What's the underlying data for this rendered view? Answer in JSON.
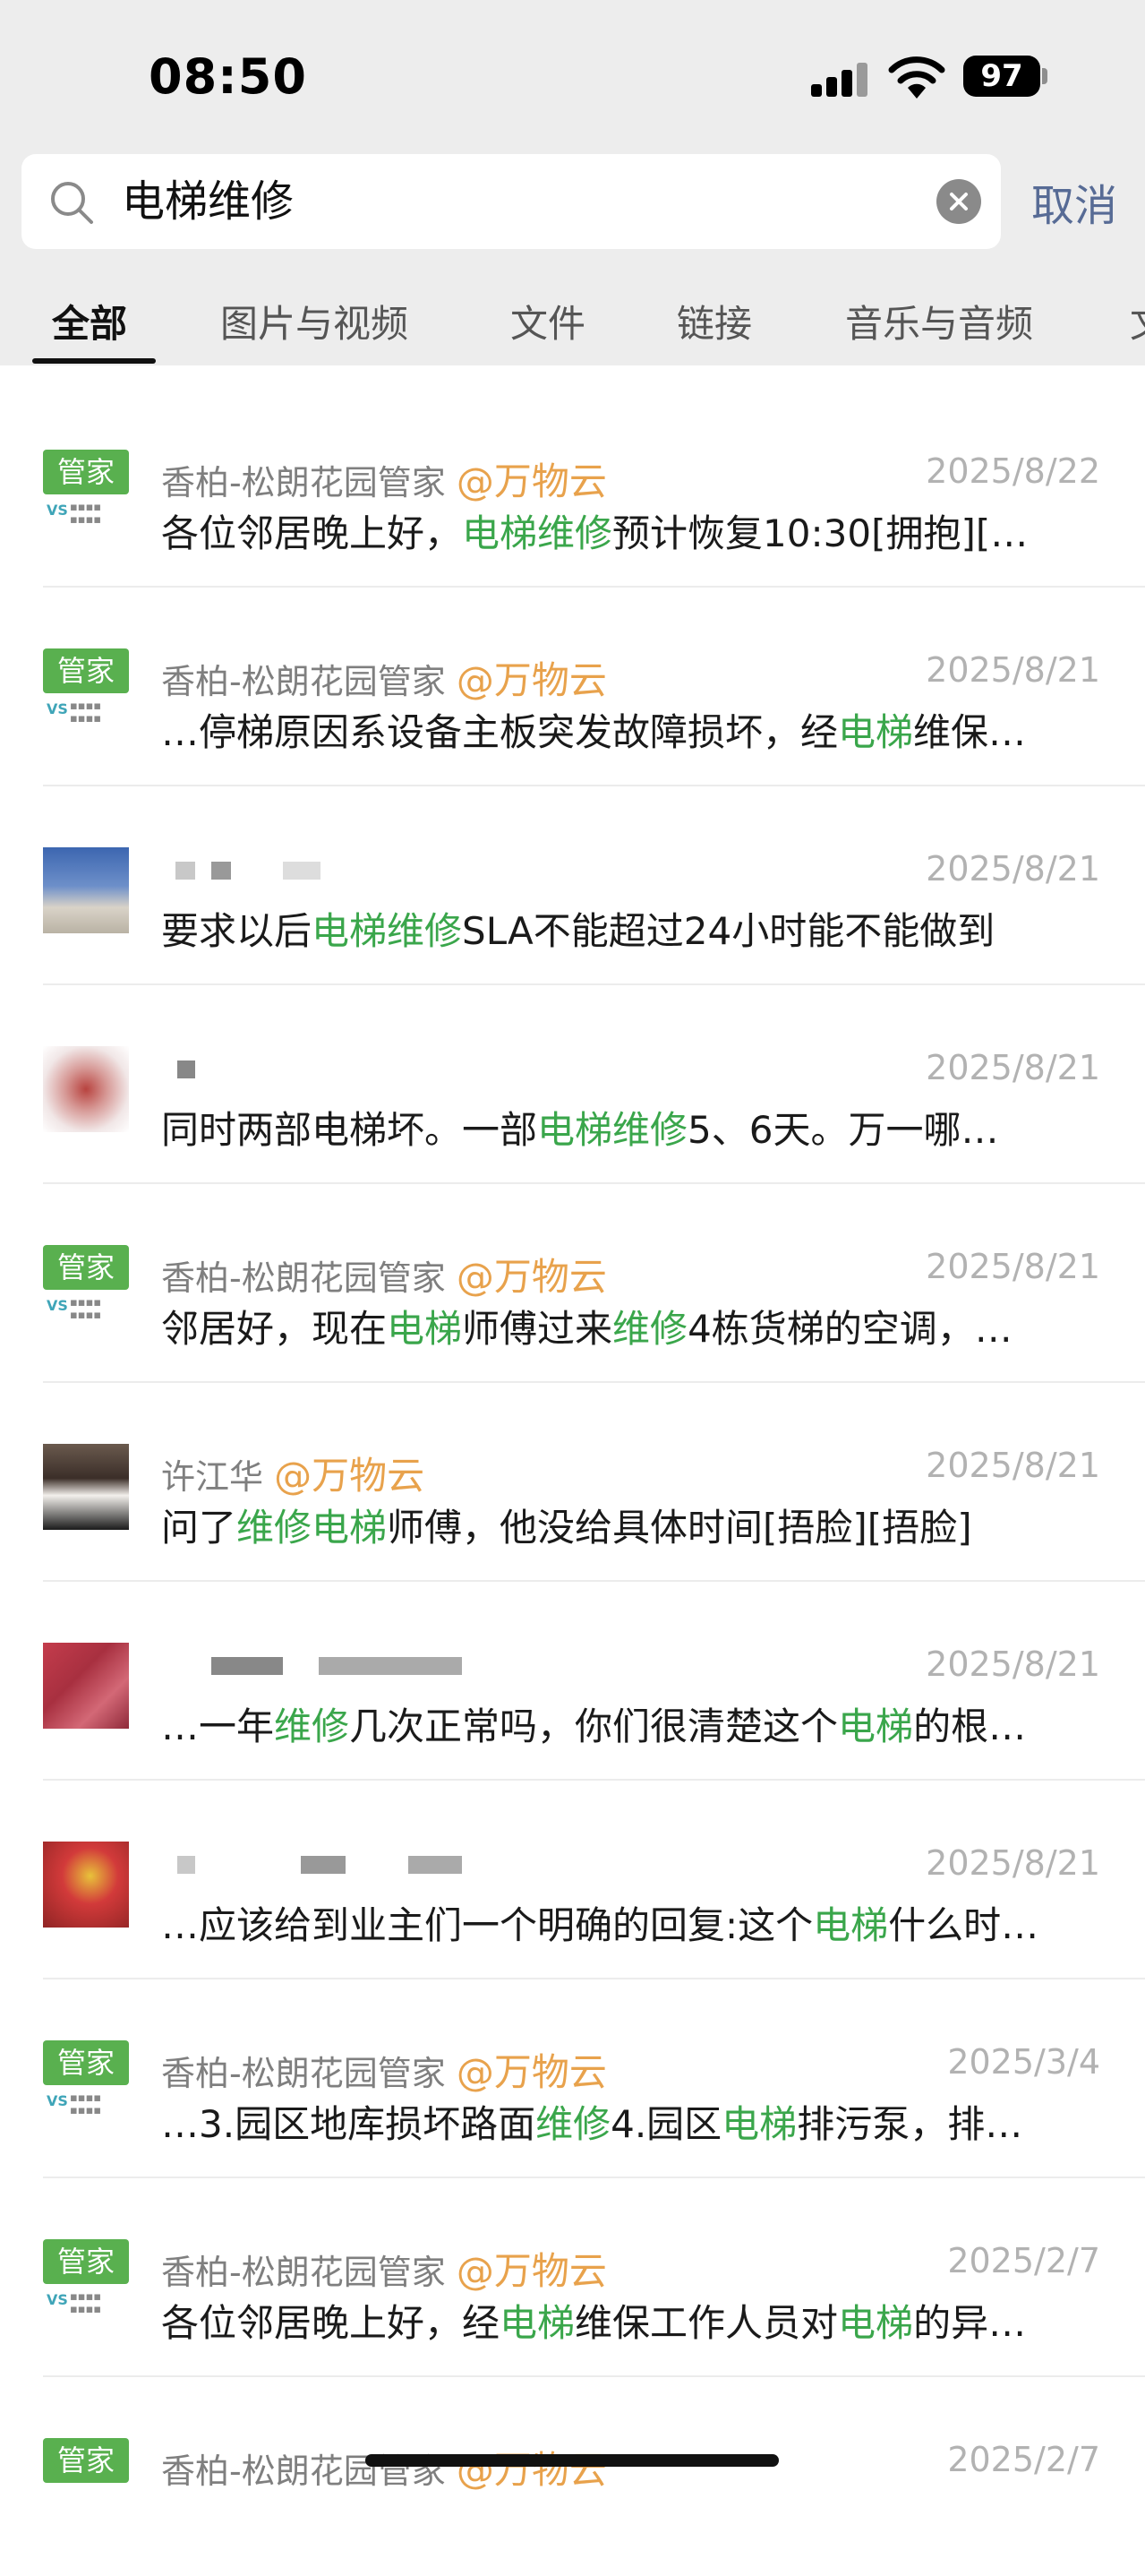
{
  "status_bar": {
    "time": "08:50",
    "battery": "97"
  },
  "search": {
    "query": "电梯维修",
    "cancel_label": "取消"
  },
  "tabs": [
    "全部",
    "图片与视频",
    "文件",
    "链接",
    "音乐与音频",
    "文"
  ],
  "results": [
    {
      "sender": "香柏-松朗花园管家",
      "mention": "@万物云",
      "date": "2025/8/22",
      "parts": [
        "各位邻居晚上好，",
        "电梯维修",
        "预计恢复10:30[拥抱][…"
      ]
    },
    {
      "sender": "香柏-松朗花园管家",
      "mention": "@万物云",
      "date": "2025/8/21",
      "parts": [
        "…停梯原因系设备主板突发故障损坏，经",
        "电梯",
        "维保…"
      ]
    },
    {
      "sender": "",
      "mention": "",
      "date": "2025/8/21",
      "parts": [
        "要求以后",
        "电梯维修",
        "SLA不能超过24小时能不能做到"
      ]
    },
    {
      "sender": "",
      "mention": "",
      "date": "2025/8/21",
      "parts": [
        "同时两部电梯坏。一部",
        "电梯维修",
        "5、6天。万一哪…"
      ]
    },
    {
      "sender": "香柏-松朗花园管家",
      "mention": "@万物云",
      "date": "2025/8/21",
      "parts": [
        "邻居好，现在",
        "电梯",
        "师傅过来",
        "维修",
        "4栋货梯的空调，…"
      ]
    },
    {
      "sender": "许江华",
      "mention": "@万物云",
      "date": "2025/8/21",
      "parts": [
        "问了",
        "维修电梯",
        "师傅，他没给具体时间[捂脸][捂脸]"
      ]
    },
    {
      "sender": "",
      "mention": "",
      "date": "2025/8/21",
      "parts": [
        "…一年",
        "维修",
        "几次正常吗，你们很清楚这个",
        "电梯",
        "的根…"
      ]
    },
    {
      "sender": "",
      "mention": "",
      "date": "2025/8/21",
      "parts": [
        "…应该给到业主们一个明确的回复:这个",
        "电梯",
        "什么时…"
      ]
    },
    {
      "sender": "香柏-松朗花园管家",
      "mention": "@万物云",
      "date": "2025/3/4",
      "parts": [
        "…3.园区地库损坏路面",
        "维修",
        "4.园区",
        "电梯",
        "排污泵，排…"
      ]
    },
    {
      "sender": "香柏-松朗花园管家",
      "mention": "@万物云",
      "date": "2025/2/7",
      "parts": [
        "各位邻居晚上好，经",
        "电梯",
        "维保工作人员对",
        "电梯",
        "的异…"
      ]
    },
    {
      "sender": "香柏-松朗花园管家",
      "mention": "@万物云",
      "date": "2025/2/7",
      "parts": [
        "",
        "",
        ""
      ]
    }
  ],
  "guanjia_badge": "管家",
  "colors": {
    "highlight": "#3aa64b",
    "mention": "#e8a24c",
    "cancel": "#576b95",
    "badge": "#59b04f"
  }
}
